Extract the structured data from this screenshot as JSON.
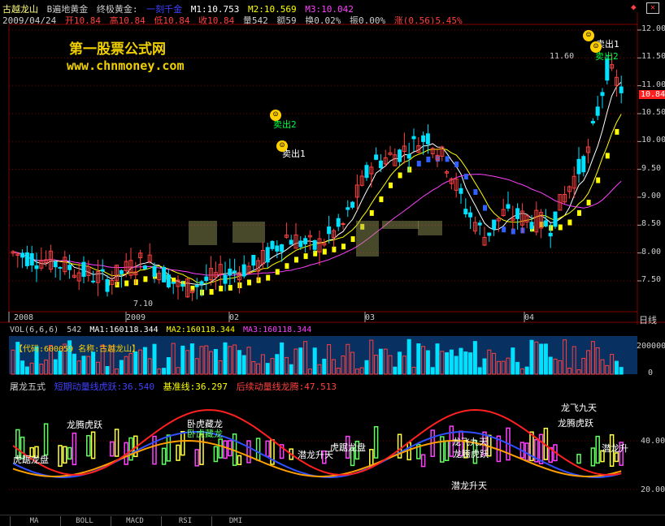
{
  "header": {
    "stock_name": "古越龙山",
    "indicator_name": "B遍地黄金",
    "indicator2": "终极黄金:",
    "indicator2_value": "一刻千金",
    "m1": "M1:10.753",
    "m2": "M2:10.569",
    "m3": "M3:10.042",
    "date": "2009/04/24",
    "open": "开10.84",
    "high": "高10.84",
    "low": "低10.84",
    "close": "收10.84",
    "volume": "量542",
    "amount": "额59",
    "turnover": "换0.02%",
    "amplitude": "振0.00%",
    "change": "涨(0.56)5.45%"
  },
  "watermark": {
    "line1": "第一股票公式网",
    "line2": "www.chnmoney.com"
  },
  "main_chart": {
    "price_labels": [
      "12.00",
      "11.50",
      "11.00",
      "10.50",
      "10.00",
      "9.50",
      "9.00",
      "8.50",
      "8.00",
      "7.50"
    ],
    "price_values": [
      12.0,
      11.5,
      11.0,
      10.5,
      10.0,
      9.5,
      9.0,
      8.5,
      8.0,
      7.5
    ],
    "current_price": "10.84",
    "high_mark": "11.60",
    "low_mark": "7.10",
    "sell_labels": [
      "卖出2",
      "卖出1",
      "卖出1",
      "卖出2"
    ],
    "date_labels": [
      "2008",
      "2009",
      "02",
      "03",
      "04"
    ],
    "period_label": "日线"
  },
  "vol_panel": {
    "title": "VOL(6,6,6)",
    "vol_value": "542",
    "ma1": "MA1:160118.344",
    "ma2": "MA2:160118.344",
    "ma3": "MA3:160118.344",
    "info": "【代码:600059 名称:古越龙山】",
    "axis_labels": [
      "200000",
      "0"
    ]
  },
  "ind_panel": {
    "title": "屠龙五式",
    "label1": "短期动量线虎跃:36.540",
    "label2": "基准线:36.297",
    "label3": "后续动量线龙腾:47.513",
    "axis_labels": [
      "40.00",
      "20.00"
    ],
    "annotations": [
      "龙腾虎跃",
      "虎踞龙盘",
      "卧虎藏龙",
      "龙飞九天",
      "潜龙升天",
      "龙腾虎跃",
      "龙飞九天",
      "虎踞龙盘",
      "潜龙升天",
      "龙腾虎跃",
      "卧虎藏龙",
      "潜龙升"
    ]
  },
  "tabs": [
    "MA",
    "BOLL",
    "MACD",
    "RSI",
    "DMI"
  ],
  "colors": {
    "up": "#ff4040",
    "down": "#00e0ff",
    "ma_white": "#ffffff",
    "ma_yellow": "#ffff00",
    "ma_magenta": "#ff40ff",
    "grid": "#800000"
  }
}
